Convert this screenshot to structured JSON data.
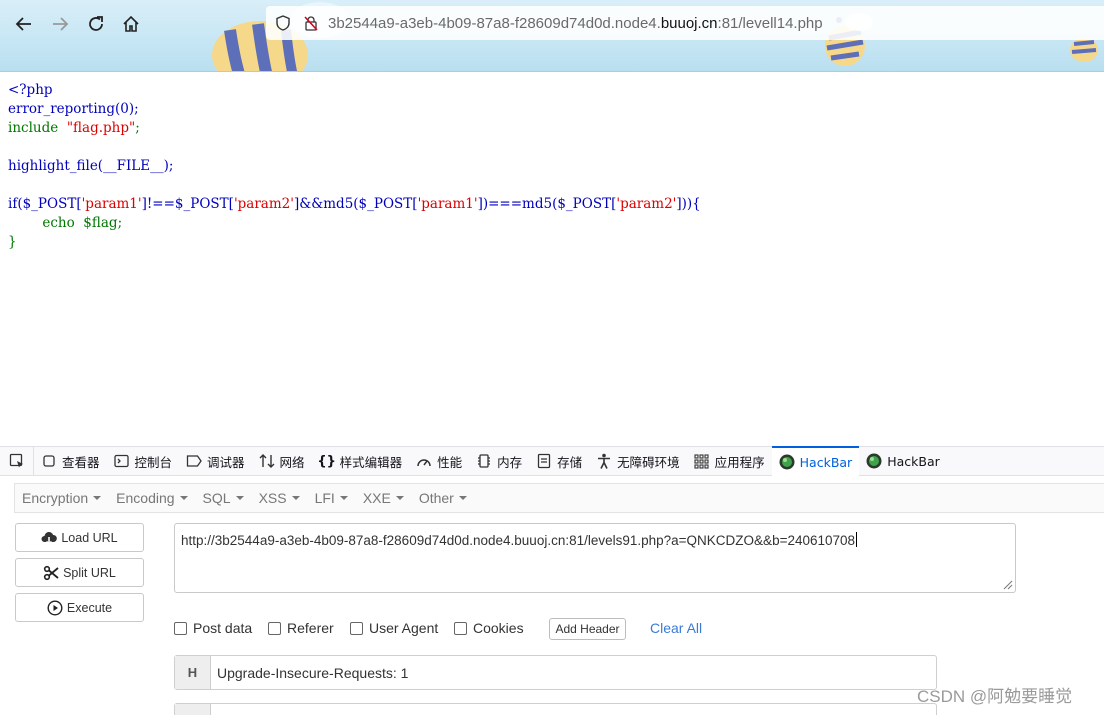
{
  "browser": {
    "url_prefix": "3b2544a9-a3eb-4b09-87a8-f28609d74d0d.node4.",
    "url_domain": "buuoj.cn",
    "url_suffix": ":81/levell14.php"
  },
  "code": {
    "line1": "<?php",
    "line2": "error_reporting(0);",
    "line3_kw": "include",
    "line3_str": "\"flag.php\"",
    "line3_end": ";",
    "line5_fn": "highlight_file(__FILE__);",
    "line7_a": "if($_POST[",
    "line7_s1": "'param1'",
    "line7_b": "]!==$_POST[",
    "line7_s2": "'param2'",
    "line7_c": "]&&md5($_POST[",
    "line7_s3": "'param1'",
    "line7_d": "])===md5($_POST[",
    "line7_s4": "'param2'",
    "line7_e": "])){",
    "line8": "        echo  $flag;",
    "line9": "}"
  },
  "devtools": {
    "tabs": [
      {
        "label": "查看器"
      },
      {
        "label": "控制台"
      },
      {
        "label": "调试器"
      },
      {
        "label": "网络"
      },
      {
        "label": "样式编辑器"
      },
      {
        "label": "性能"
      },
      {
        "label": "内存"
      },
      {
        "label": "存储"
      },
      {
        "label": "无障碍环境"
      },
      {
        "label": "应用程序"
      },
      {
        "label": "HackBar"
      },
      {
        "label": "HackBar"
      }
    ],
    "active_tab": "HackBar",
    "accent_color": "#0060df"
  },
  "hackbar": {
    "menu": [
      "Encryption",
      "Encoding",
      "SQL",
      "XSS",
      "LFI",
      "XXE",
      "Other"
    ],
    "buttons": {
      "load": "Load URL",
      "split": "Split URL",
      "execute": "Execute"
    },
    "url_value": "http://3b2544a9-a3eb-4b09-87a8-f28609d74d0d.node4.buuoj.cn:81/levels91.php?a=QNKCDZO&&b=240610708",
    "options": {
      "post": "Post data",
      "referer": "Referer",
      "user_agent": "User Agent",
      "cookies": "Cookies"
    },
    "add_header": "Add Header",
    "clear_all": "Clear All",
    "header_tag": "H",
    "header_value": "Upgrade-Insecure-Requests: 1"
  },
  "watermark": "CSDN @阿勉要睡觉"
}
